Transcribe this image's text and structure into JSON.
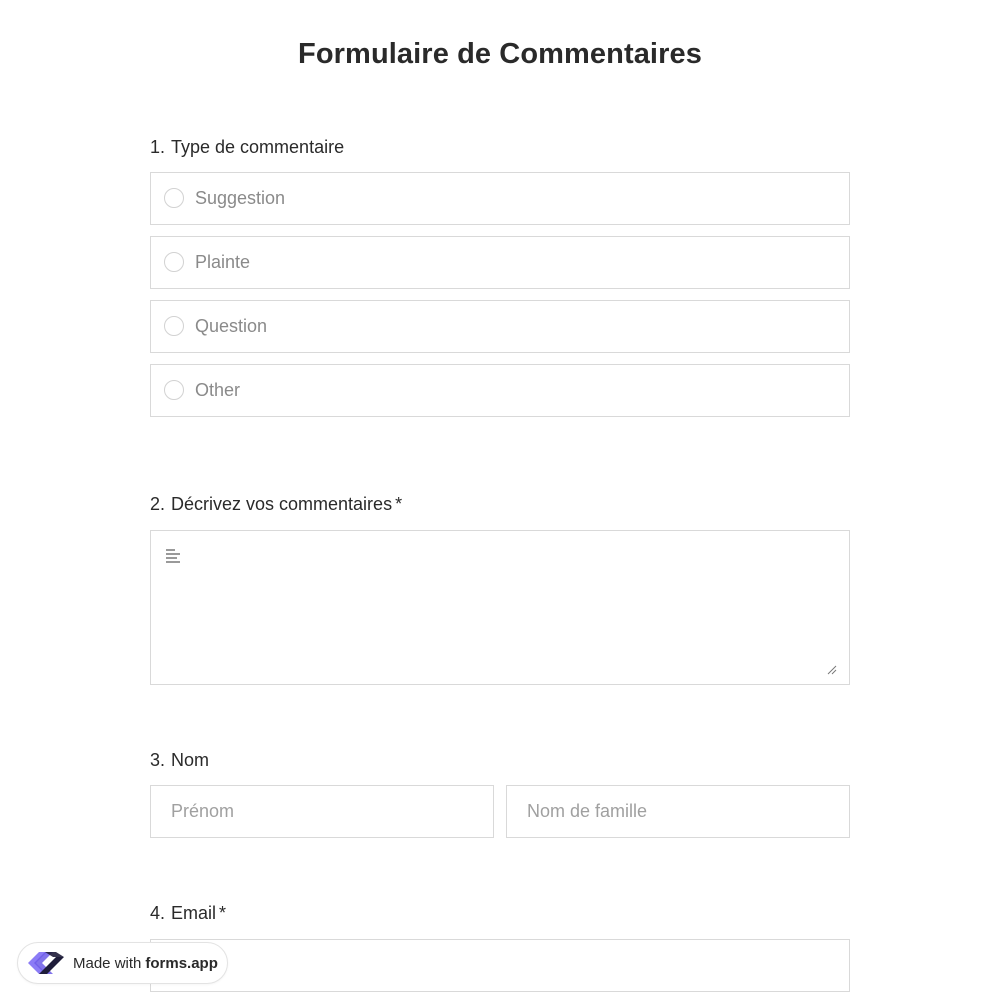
{
  "form": {
    "title": "Formulaire de Commentaires"
  },
  "questions": {
    "q1": {
      "number": "1.",
      "label": "Type de commentaire",
      "options": [
        "Suggestion",
        "Plainte",
        "Question",
        "Other"
      ]
    },
    "q2": {
      "number": "2.",
      "label": "Décrivez vos commentaires",
      "required": "*",
      "value": ""
    },
    "q3": {
      "number": "3.",
      "label": "Nom",
      "first_placeholder": "Prénom",
      "last_placeholder": "Nom de famille"
    },
    "q4": {
      "number": "4.",
      "label": "Email",
      "required": "*"
    }
  },
  "badge": {
    "prefix": "Made with",
    "brand": "forms.app"
  },
  "icons": {
    "radio": "radio-empty-icon",
    "textarea": "text-lines-icon",
    "resize": "resize-handle-icon",
    "logo": "forms-app-logo-icon"
  },
  "colors": {
    "border": "#d9d9d9",
    "placeholder": "#a0a0a0",
    "logo_purple": "#6c5ce7",
    "logo_dark": "#1f1d3a"
  }
}
